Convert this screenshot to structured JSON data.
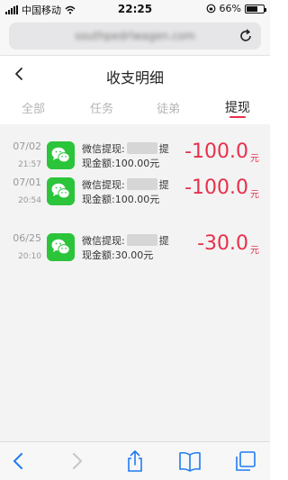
{
  "status": {
    "carrier": "中国移动",
    "time": "22:25",
    "battery": "66%",
    "battery_level": 0.66
  },
  "browser": {
    "url": "southpedrlwagen.com"
  },
  "page": {
    "title": "收支明细"
  },
  "tabs": [
    {
      "label": "全部",
      "active": false
    },
    {
      "label": "任务",
      "active": false
    },
    {
      "label": "徒弟",
      "active": false
    },
    {
      "label": "提现",
      "active": true
    }
  ],
  "records": [
    {
      "date": "07/02",
      "time": "21:57",
      "desc_prefix": "微信提现:",
      "desc_suffix": "提",
      "desc_line2": "现金额:100.00元",
      "amount": "-100.0",
      "unit": "元"
    },
    {
      "date": "07/01",
      "time": "20:54",
      "desc_prefix": "微信提现:",
      "desc_suffix": "提",
      "desc_line2": "现金额:100.00元",
      "amount": "-100.0",
      "unit": "元"
    },
    {
      "date": "06/25",
      "time": "20:10",
      "desc_prefix": "微信提现:",
      "desc_suffix": "提",
      "desc_line2": "现金额:30.00元",
      "amount": "-30.0",
      "unit": "元"
    }
  ],
  "colors": {
    "accent": "#e8304b",
    "wechat": "#2bc43a",
    "ios_blue": "#1f7cf0"
  },
  "icons": {
    "back": "chevron-left-icon",
    "reload": "reload-icon",
    "wechat": "wechat-icon",
    "share": "share-icon",
    "bookmarks": "book-icon",
    "tabs": "tabs-icon"
  }
}
